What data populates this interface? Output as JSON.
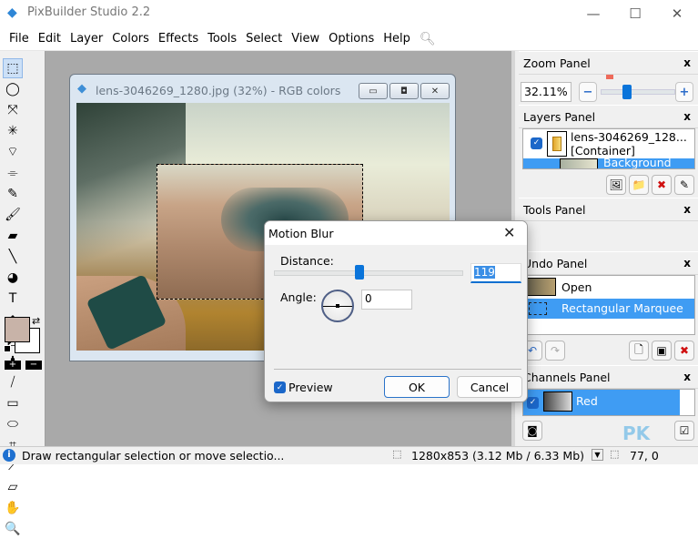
{
  "app": {
    "title": "PixBuilder Studio 2.2"
  },
  "window_controls": {
    "minimize": "—",
    "maximize": "☐",
    "close": "✕"
  },
  "menu": [
    "File",
    "Edit",
    "Layer",
    "Colors",
    "Effects",
    "Tools",
    "Select",
    "View",
    "Options",
    "Help"
  ],
  "toolbox": {
    "tools": [
      {
        "name": "rectangular-marquee-tool",
        "glyph": "⬚",
        "active": true
      },
      {
        "name": "lasso-tool",
        "glyph": "◯"
      },
      {
        "name": "move-tool",
        "glyph": "⤧"
      },
      {
        "name": "magic-wand-tool",
        "glyph": "✳"
      },
      {
        "name": "polygon-lasso-tool",
        "glyph": "⌔"
      },
      {
        "name": "magnetic-lasso-tool",
        "glyph": "⌯"
      },
      {
        "name": "pencil-tool",
        "glyph": "✎"
      },
      {
        "name": "brush-tool",
        "glyph": "🖌"
      },
      {
        "name": "eraser-tool",
        "glyph": "▰"
      },
      {
        "name": "line-tool",
        "glyph": "╲"
      },
      {
        "name": "paint-bucket-tool",
        "glyph": "◕"
      },
      {
        "name": "text-tool",
        "glyph": "T"
      },
      {
        "name": "gradient-tool",
        "glyph": "◆"
      },
      {
        "name": "fill-tool",
        "glyph": "◩"
      },
      {
        "name": "clone-stamp-tool",
        "glyph": "♟"
      },
      {
        "name": "healing-tool",
        "glyph": "⧸"
      },
      {
        "name": "rectangle-shape-tool",
        "glyph": "▭"
      },
      {
        "name": "ellipse-shape-tool",
        "glyph": "⬭"
      },
      {
        "name": "crop-tool",
        "glyph": "⌗"
      },
      {
        "name": "eyedropper-tool",
        "glyph": "⟋"
      },
      {
        "name": "measure-tool",
        "glyph": "▱"
      },
      {
        "name": "hand-tool",
        "glyph": "✋"
      },
      {
        "name": "zoom-tool",
        "glyph": "🔍"
      }
    ],
    "foreground_color": "#c8b3a8",
    "background_color": "#ffffff",
    "plus": "+",
    "minus": "−"
  },
  "document": {
    "title": "lens-3046269_1280.jpg (32%) - RGB colors"
  },
  "dialog": {
    "title": "Motion Blur",
    "distance_label": "Distance:",
    "distance_value": "119",
    "distance_fraction": 0.45,
    "angle_label": "Angle:",
    "angle_value": "0",
    "preview_label": "Preview",
    "preview_checked": true,
    "ok_label": "OK",
    "cancel_label": "Cancel"
  },
  "panels": {
    "zoom": {
      "title": "Zoom Panel",
      "value": "32.11%",
      "minus": "−",
      "plus": "+"
    },
    "layers": {
      "title": "Layers Panel",
      "items": [
        {
          "name": "lens-3046269_128...",
          "sub": "[Container]"
        },
        {
          "name": "Background"
        }
      ]
    },
    "tools": {
      "title": "Tools Panel"
    },
    "undo": {
      "title": "Undo Panel",
      "items": [
        "Open",
        "Rectangular Marquee"
      ]
    },
    "channels": {
      "title": "Channels Panel",
      "items": [
        "Red"
      ]
    },
    "close": "x"
  },
  "status": {
    "message": "Draw rectangular selection or move selectio...",
    "image_info": "1280x853  (3.12 Mb / 6.33 Mb)",
    "coords": "77, 0"
  },
  "watermark": "PK"
}
